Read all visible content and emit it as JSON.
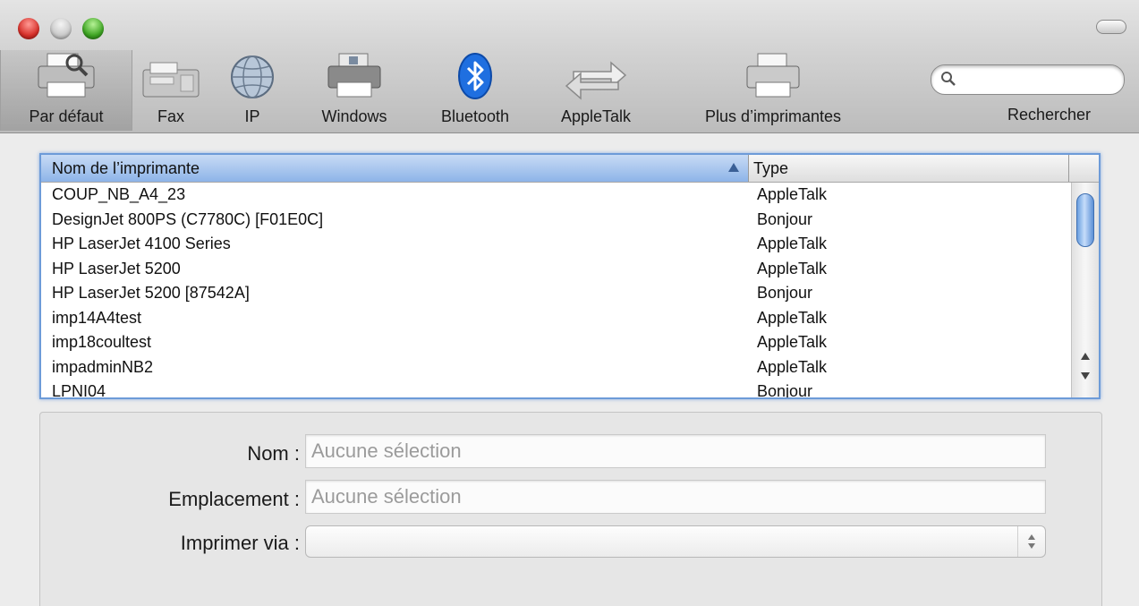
{
  "toolbar": {
    "items": [
      {
        "label": "Par défaut",
        "icon": "default-printer-icon",
        "selected": true
      },
      {
        "label": "Fax",
        "icon": "fax-icon",
        "selected": false
      },
      {
        "label": "IP",
        "icon": "globe-icon",
        "selected": false
      },
      {
        "label": "Windows",
        "icon": "windows-printer-icon",
        "selected": false
      },
      {
        "label": "Bluetooth",
        "icon": "bluetooth-icon",
        "selected": false
      },
      {
        "label": "AppleTalk",
        "icon": "appletalk-icon",
        "selected": false
      },
      {
        "label": "Plus d’imprimantes",
        "icon": "more-printers-icon",
        "selected": false
      }
    ],
    "search_label": "Rechercher",
    "search_value": ""
  },
  "list": {
    "headers": {
      "name": "Nom de l’imprimante",
      "type": "Type"
    },
    "rows": [
      {
        "name": "COUP_NB_A4_23",
        "type": "AppleTalk"
      },
      {
        "name": "DesignJet 800PS (C7780C) [F01E0C]",
        "type": "Bonjour"
      },
      {
        "name": "HP LaserJet 4100 Series",
        "type": "AppleTalk"
      },
      {
        "name": "HP LaserJet 5200",
        "type": "AppleTalk"
      },
      {
        "name": "HP LaserJet 5200 [87542A]",
        "type": "Bonjour"
      },
      {
        "name": "imp14A4test",
        "type": "AppleTalk"
      },
      {
        "name": "imp18coultest",
        "type": "AppleTalk"
      },
      {
        "name": "impadminNB2",
        "type": "AppleTalk"
      },
      {
        "name": "LPNI04",
        "type": "Bonjour"
      }
    ]
  },
  "details": {
    "name_label": "Nom :",
    "name_placeholder": "Aucune sélection",
    "location_label": "Emplacement :",
    "location_placeholder": "Aucune sélection",
    "print_via_label": "Imprimer via :",
    "print_via_value": ""
  },
  "colors": {
    "selection_blue": "#8db4e8",
    "focus_ring": "#6d9bd8",
    "bluetooth": "#1f6fe0"
  }
}
